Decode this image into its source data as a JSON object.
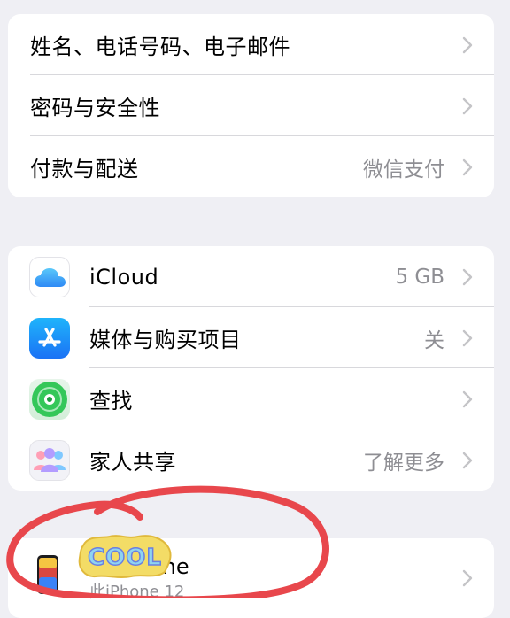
{
  "account_group": {
    "items": [
      {
        "label": "姓名、电话号码、电子邮件",
        "value": ""
      },
      {
        "label": "密码与安全性",
        "value": ""
      },
      {
        "label": "付款与配送",
        "value": "微信支付"
      }
    ]
  },
  "services_group": {
    "items": [
      {
        "label": "iCloud",
        "value": "5 GB",
        "icon": "icloud-icon"
      },
      {
        "label": "媒体与购买项目",
        "value": "关",
        "icon": "app-store-icon"
      },
      {
        "label": "查找",
        "value": "",
        "icon": "find-my-icon"
      },
      {
        "label": "家人共享",
        "value": "了解更多",
        "icon": "family-sharing-icon"
      }
    ]
  },
  "device_group": {
    "name": "的 iPhone",
    "subtitle": "此iPhone 12",
    "icon": "iphone-icon"
  },
  "overlays": {
    "sticker_text": "COOL",
    "scribble_color": "#e8474c"
  },
  "colors": {
    "background": "#efeff4",
    "secondary_text": "#8e8e93",
    "chevron": "#c4c4c7"
  }
}
